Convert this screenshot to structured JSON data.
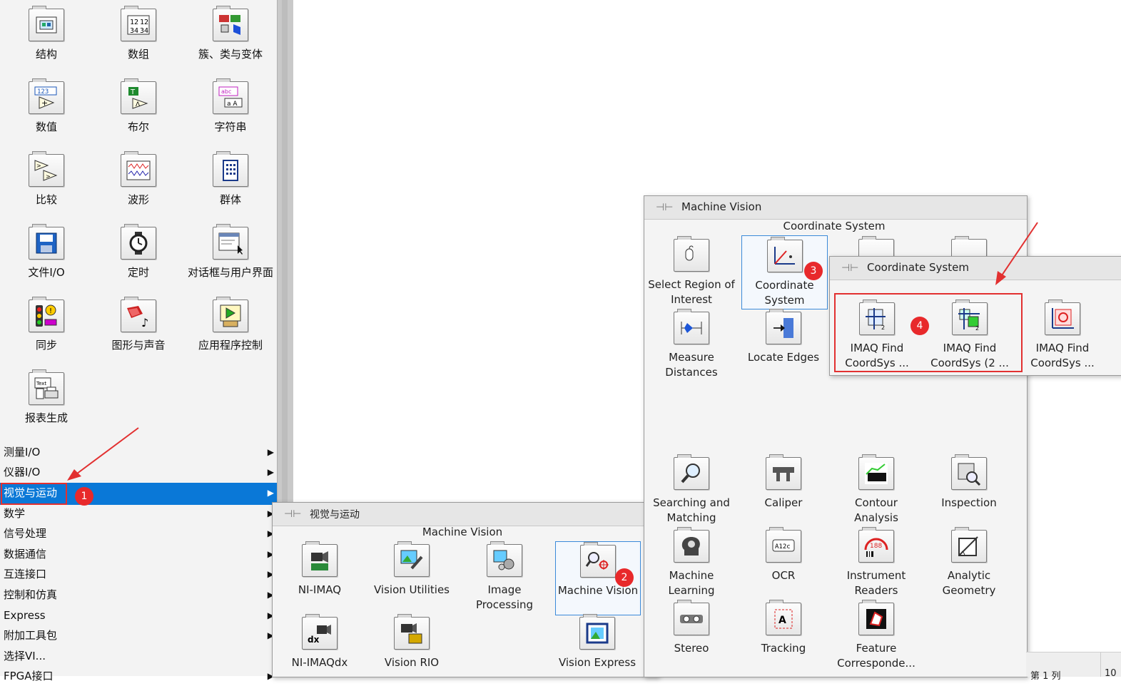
{
  "palette": {
    "items": [
      {
        "label": "结构",
        "icon": "structure-icon"
      },
      {
        "label": "数组",
        "icon": "array-icon"
      },
      {
        "label": "簇、类与变体",
        "icon": "cluster-icon"
      },
      {
        "label": "数值",
        "icon": "numeric-icon"
      },
      {
        "label": "布尔",
        "icon": "boolean-icon"
      },
      {
        "label": "字符串",
        "icon": "string-icon"
      },
      {
        "label": "比较",
        "icon": "comparison-icon"
      },
      {
        "label": "波形",
        "icon": "waveform-icon"
      },
      {
        "label": "群体",
        "icon": "group-icon"
      },
      {
        "label": "文件I/O",
        "icon": "file-io-icon"
      },
      {
        "label": "定时",
        "icon": "timing-icon"
      },
      {
        "label": "对话框与用户界面",
        "icon": "dialog-icon"
      },
      {
        "label": "同步",
        "icon": "sync-icon"
      },
      {
        "label": "图形与声音",
        "icon": "graphics-sound-icon"
      },
      {
        "label": "应用程序控制",
        "icon": "app-control-icon"
      },
      {
        "label": "报表生成",
        "icon": "report-icon"
      }
    ],
    "categories": [
      {
        "label": "测量I/O",
        "selected": false
      },
      {
        "label": "仪器I/O",
        "selected": false
      },
      {
        "label": "视觉与运动",
        "selected": true
      },
      {
        "label": "数学",
        "selected": false
      },
      {
        "label": "信号处理",
        "selected": false
      },
      {
        "label": "数据通信",
        "selected": false
      },
      {
        "label": "互连接口",
        "selected": false
      },
      {
        "label": "控制和仿真",
        "selected": false
      },
      {
        "label": "Express",
        "selected": false
      },
      {
        "label": "附加工具包",
        "selected": false
      },
      {
        "label": "选择VI...",
        "selected": false
      },
      {
        "label": "FPGA接口",
        "selected": false
      }
    ]
  },
  "vision_popup": {
    "title": "视觉与运动",
    "subtitle": "Machine Vision",
    "items": [
      {
        "label": "NI-IMAQ",
        "icon": "camera-icon"
      },
      {
        "label": "Vision Utilities",
        "icon": "vision-utilities-icon"
      },
      {
        "label": "Image Processing",
        "icon": "image-processing-icon"
      },
      {
        "label": "Machine Vision",
        "icon": "machine-vision-icon"
      },
      {
        "label": "NI-IMAQdx",
        "icon": "imaqdx-icon"
      },
      {
        "label": "Vision RIO",
        "icon": "vision-rio-icon"
      },
      {
        "label": "Vision Express",
        "icon": "vision-express-icon"
      }
    ]
  },
  "mv_popup": {
    "title": "Machine Vision",
    "subtitle": "Coordinate System",
    "items": [
      {
        "label": "Select Region of Interest",
        "icon": "select-roi-icon"
      },
      {
        "label": "Coordinate System",
        "icon": "coordinate-system-icon"
      },
      {
        "label": "Measure Distances",
        "icon": "measure-distances-icon"
      },
      {
        "label": "Locate Edges",
        "icon": "locate-edges-icon"
      },
      {
        "label": "Searching and Matching",
        "icon": "search-match-icon"
      },
      {
        "label": "Caliper",
        "icon": "caliper-icon"
      },
      {
        "label": "Contour Analysis",
        "icon": "contour-icon"
      },
      {
        "label": "Inspection",
        "icon": "inspection-icon"
      },
      {
        "label": "Machine Learning",
        "icon": "machine-learning-icon"
      },
      {
        "label": "OCR",
        "icon": "ocr-icon"
      },
      {
        "label": "Instrument Readers",
        "icon": "instrument-readers-icon"
      },
      {
        "label": "Analytic Geometry",
        "icon": "analytic-geometry-icon"
      },
      {
        "label": "Stereo",
        "icon": "stereo-icon"
      },
      {
        "label": "Tracking",
        "icon": "tracking-icon"
      },
      {
        "label": "Feature Corresponde...",
        "icon": "feature-icon"
      }
    ]
  },
  "cs_popup": {
    "title": "Coordinate System",
    "items": [
      {
        "label": "IMAQ Find CoordSys ...",
        "icon": "find-coordsys-rect-icon"
      },
      {
        "label": "IMAQ Find CoordSys (2 ...",
        "icon": "find-coordsys-2rect-icon"
      },
      {
        "label": "IMAQ Find CoordSys ...",
        "icon": "find-coordsys-pattern-icon"
      }
    ]
  },
  "badges": [
    "1",
    "2",
    "3",
    "4"
  ],
  "status": {
    "text": "第 1 列",
    "extra": "10"
  },
  "colors": {
    "selection": "#0a78d7",
    "annotation": "#e23030"
  }
}
